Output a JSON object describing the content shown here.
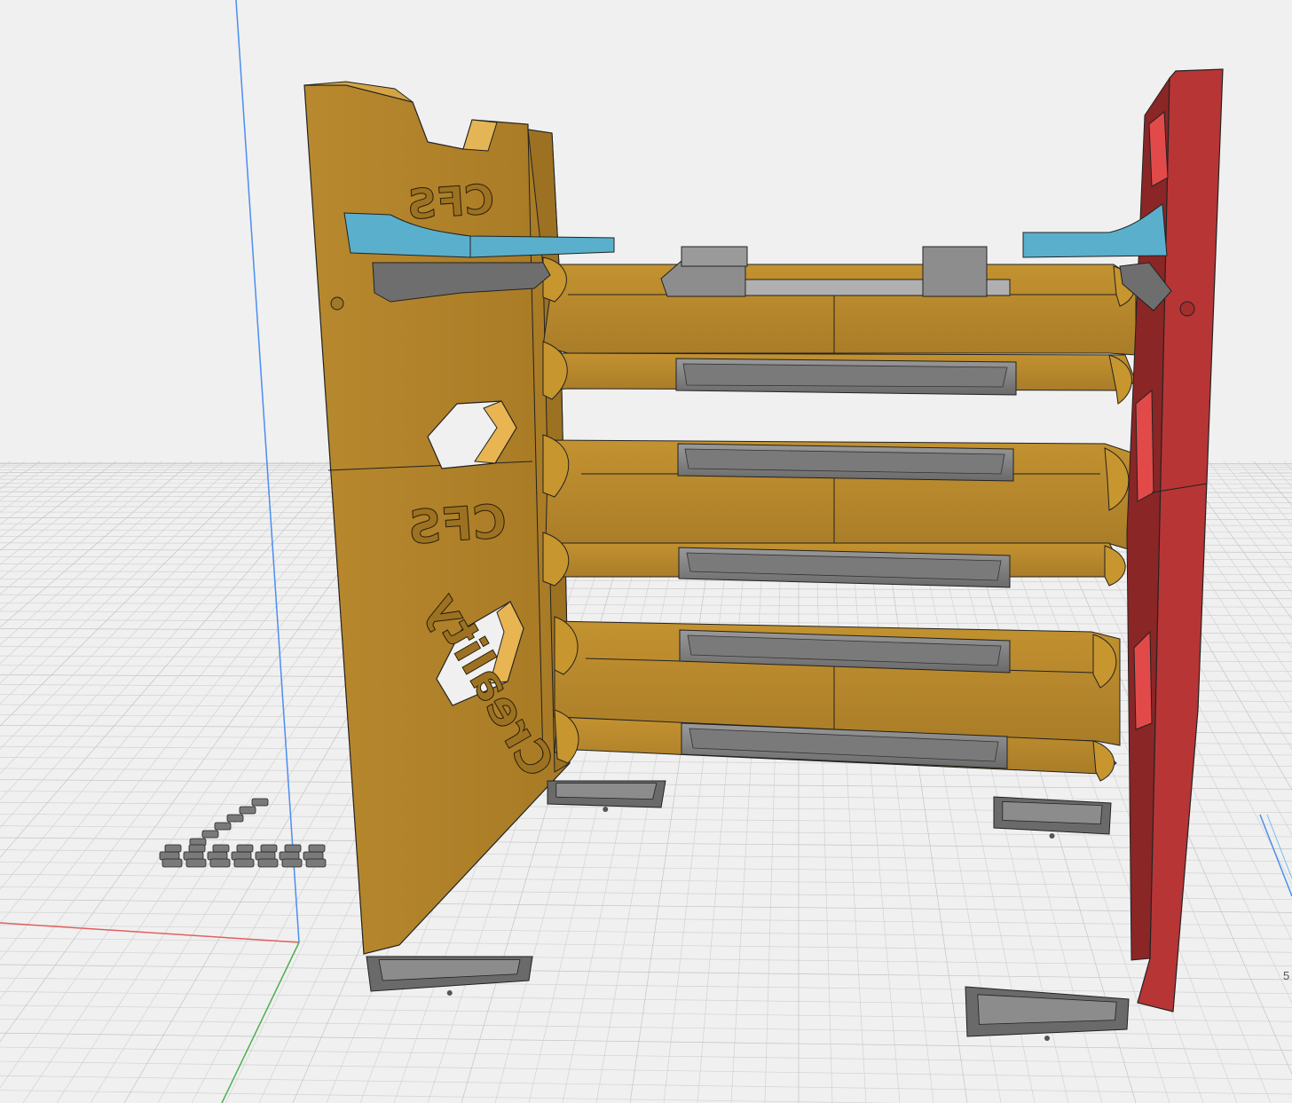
{
  "viewport": {
    "background": "#f0f0f0",
    "colors": {
      "grid_line": "#d2d2d2",
      "grid_line_major": "#c4c4c4",
      "axis_x": "#e06060",
      "axis_y": "#4caf50",
      "axis_z": "#4a8ef0",
      "panel_tan": "#b8892e",
      "panel_tan_dark": "#8a6420",
      "panel_tan_light": "#d8aa4a",
      "panel_red": "#b83535",
      "panel_red_dark": "#7a1f1f",
      "accent_blue": "#5ab0cc",
      "part_grey": "#8a8a8a",
      "part_grey_dark": "#5c5c5c",
      "outline": "#222222"
    }
  },
  "model": {
    "left_panel": {
      "label_top": "CFS",
      "label_middle": "CFS",
      "label_bottom": "Creality"
    },
    "right_panel": {
      "label": ""
    },
    "shelf_count": 6,
    "foot_count": 6
  },
  "corner_readout": "5"
}
